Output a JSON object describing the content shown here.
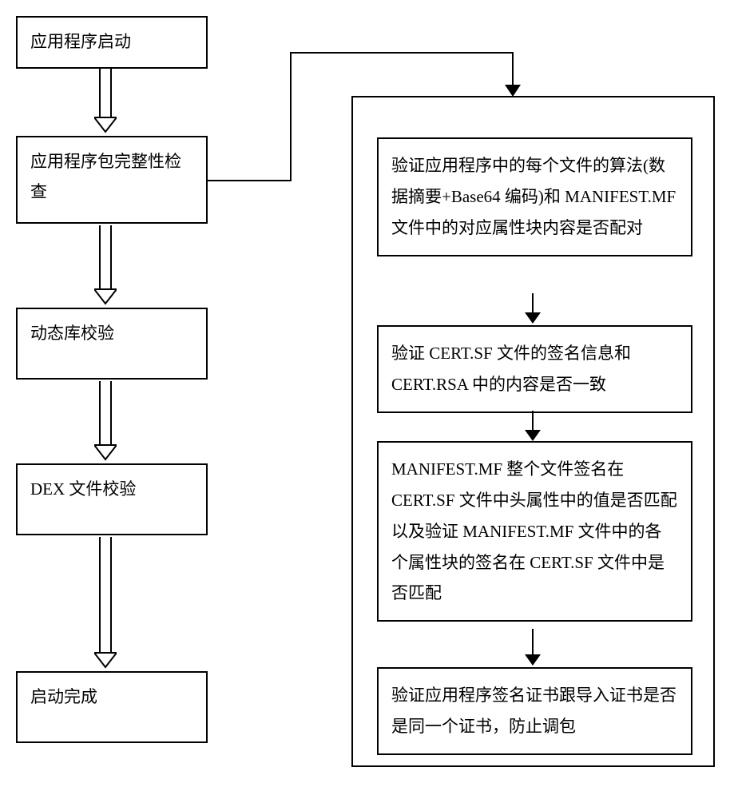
{
  "left": {
    "step1": "应用程序启动",
    "step2": "应用程序包完整性检查",
    "step3": "动态库校验",
    "step4": "DEX 文件校验",
    "step5": "启动完成"
  },
  "right": {
    "sub1": "验证应用程序中的每个文件的算法(数据摘要+Base64 编码)和 MANIFEST.MF 文件中的对应属性块内容是否配对",
    "sub2": "验证 CERT.SF 文件的签名信息和 CERT.RSA 中的内容是否一致",
    "sub3": "MANIFEST.MF 整个文件签名在 CERT.SF 文件中头属性中的值是否匹配以及验证 MANIFEST.MF 文件中的各个属性块的签名在 CERT.SF 文件中是否匹配",
    "sub4": "验证应用程序签名证书跟导入证书是否是同一个证书，防止调包"
  }
}
